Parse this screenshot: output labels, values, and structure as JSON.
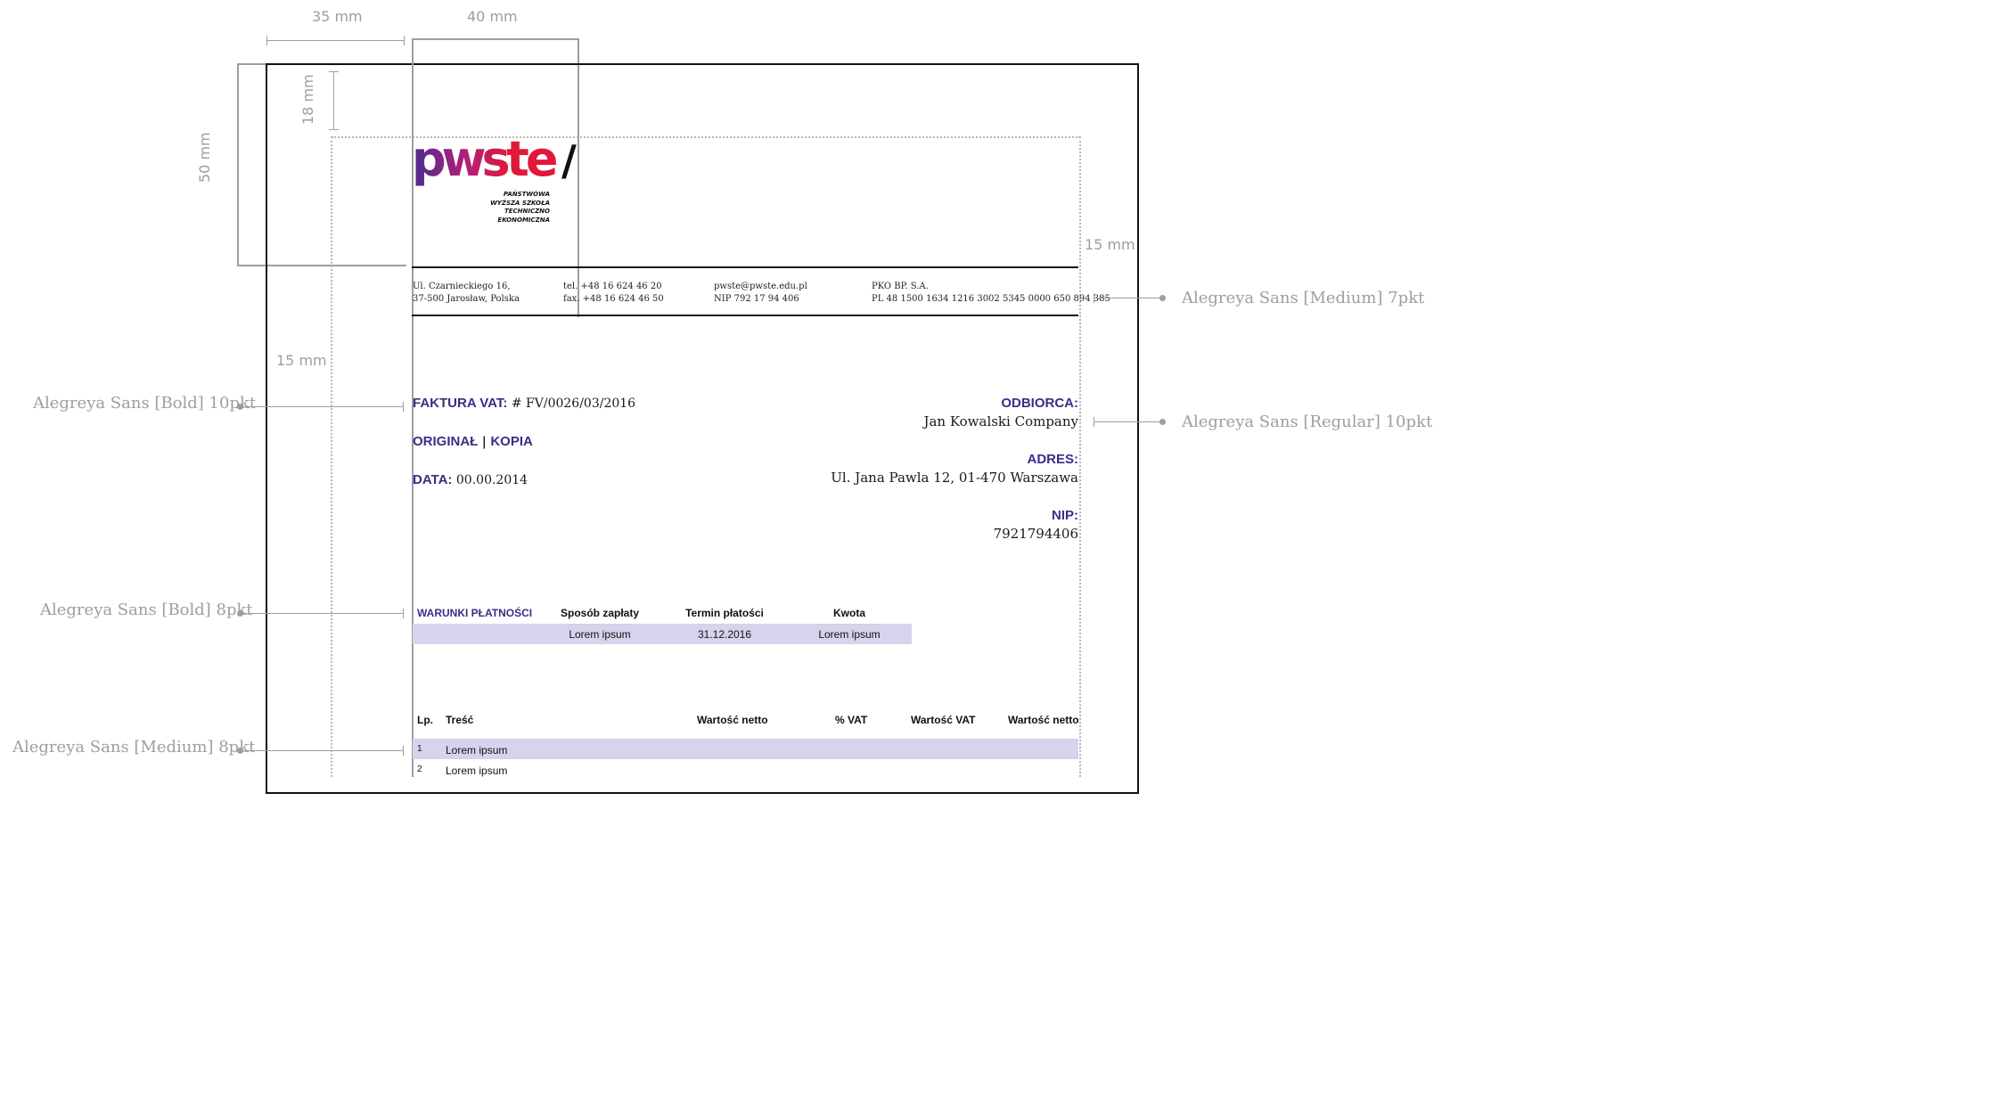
{
  "dimensions": {
    "left_margin": "35 mm",
    "logo_width": "40 mm",
    "header_height": "50 mm",
    "top_offset": "18 mm",
    "right_margin": "15 mm",
    "left_inner_margin": "15 mm"
  },
  "annotations": {
    "contact_font": "Alegreya Sans [Medium] 7pkt",
    "heading_font": "Alegreya Sans [Bold] 10pkt",
    "body_font": "Alegreya Sans [Regular] 10pkt",
    "table_header_font": "Alegreya Sans [Bold] 8pkt",
    "table_body_font": "Alegreya Sans [Medium] 8pkt"
  },
  "logo": {
    "text_pws": "pws",
    "text_te": "te",
    "slash": "/",
    "line1": "PAŃSTWOWA",
    "line2": "WYŻSZA SZKOŁA",
    "line3": "TECHNICZNO",
    "line4": "EKONOMICZNA"
  },
  "contact": {
    "address_line1": "Ul. Czarnieckiego 16,",
    "address_line2": "37-500 Jarosław, Polska",
    "tel": "tel. +48 16 624 46 20",
    "fax": "fax. +48 16 624 46 50",
    "email": "pwste@pwste.edu.pl",
    "nip": "NIP 792 17 94 406",
    "bank": "PKO BP. S.A.",
    "account": "PL 48 1500 1634 1216 3002 5345 0000 650 894 385"
  },
  "invoice": {
    "title_label": "FAKTURA VAT:",
    "number": "# FV/0026/03/2016",
    "original_label": "ORIGINAŁ",
    "separator": "|",
    "copy_label": "KOPIA",
    "date_label": "DATA:",
    "date_value": "00.00.2014"
  },
  "recipient": {
    "label": "ODBIORCA:",
    "name": "Jan Kowalski Company",
    "address_label": "ADRES:",
    "address": "Ul. Jana Pawla 12, 01-470 Warszawa",
    "nip_label": "NIP:",
    "nip": "7921794406"
  },
  "payment_table": {
    "title": "WARUNKI PŁATNOŚCI",
    "headers": [
      "Sposób zapłaty",
      "Termin płatości",
      "Kwota"
    ],
    "row": [
      "Lorem ipsum",
      "31.12.2016",
      "Lorem ipsum"
    ]
  },
  "items_table": {
    "headers": [
      "Lp.",
      "Treść",
      "Wartość netto",
      "% VAT",
      "Wartość VAT",
      "Wartość netto"
    ],
    "rows": [
      {
        "lp": "1",
        "text": "Lorem ipsum"
      },
      {
        "lp": "2",
        "text": "Lorem ipsum"
      }
    ]
  },
  "colors": {
    "accent": "#3f2b87",
    "table_band": "#d6d3ec",
    "annotation": "#9e9e9e",
    "logo_gradient_start": "#4a2c8f",
    "logo_gradient_end": "#e0193a"
  }
}
